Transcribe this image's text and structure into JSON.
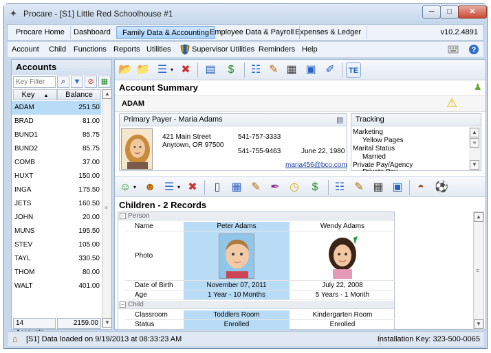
{
  "window": {
    "title": "Procare - [S1] Little Red Schoolhouse #1",
    "min": "─",
    "max": "□",
    "close": "✕"
  },
  "tabs": [
    {
      "label": "Procare Home"
    },
    {
      "label": "Dashboard"
    },
    {
      "label": "Family Data & Accounting"
    },
    {
      "label": "Employee Data & Payroll"
    },
    {
      "label": "Expenses & Ledger"
    }
  ],
  "version": "v10.2.4891",
  "menu": {
    "account": "Account",
    "child": "Child",
    "functions": "Functions",
    "reports": "Reports",
    "utilities": "Utilities",
    "supervisor": "Supervisor Utilities",
    "reminders": "Reminders",
    "help": "Help"
  },
  "sidebar": {
    "title": "Accounts",
    "filter_placeholder": "Key Filter",
    "col_key": "Key",
    "col_balance": "Balance",
    "rows": [
      {
        "key": "ADAM",
        "balance": "251.50"
      },
      {
        "key": "BRAD",
        "balance": "81.00"
      },
      {
        "key": "BUND1",
        "balance": "85.75"
      },
      {
        "key": "BUND2",
        "balance": "85.75"
      },
      {
        "key": "COMB",
        "balance": "37.00"
      },
      {
        "key": "HUXT",
        "balance": "150.00"
      },
      {
        "key": "INGA",
        "balance": "175.50"
      },
      {
        "key": "JETS",
        "balance": "160.50"
      },
      {
        "key": "JOHN",
        "balance": "20.00"
      },
      {
        "key": "MUNS",
        "balance": "195.50"
      },
      {
        "key": "STEV",
        "balance": "105.00"
      },
      {
        "key": "TAYL",
        "balance": "330.50"
      },
      {
        "key": "THOM",
        "balance": "80.00"
      },
      {
        "key": "WALT",
        "balance": "401.00"
      }
    ],
    "footer_count": "14 Accounts",
    "footer_total": "2159.00"
  },
  "summary": {
    "title": "Account Summary",
    "account_key": "ADAM",
    "primary_payer_label": "Primary Payer - Maria Adams",
    "address1": "421 Main Street",
    "address2": "Anytown, OR  97500",
    "phone1": "541-757-3333",
    "phone2": "541-755-9463",
    "date": "June 22, 1980",
    "email": "maria456@bco.com",
    "tracking_title": "Tracking",
    "tracking": [
      "Marketing",
      "Yellow Pages",
      "Marital Status",
      "Married",
      "Private Pay/Agency",
      "Private Pay"
    ]
  },
  "children": {
    "title": "Children - 2 Records",
    "group_person": "Person",
    "group_child": "Child",
    "labels": {
      "name": "Name",
      "photo": "Photo",
      "dob": "Date of Birth",
      "age": "Age",
      "classroom": "Classroom",
      "status": "Status"
    },
    "kids": [
      {
        "name": "Peter Adams",
        "dob": "November 07, 2011",
        "age": "1 Year - 10 Months",
        "classroom": "Toddlers Room",
        "status": "Enrolled"
      },
      {
        "name": "Wendy Adams",
        "dob": "July 22, 2008",
        "age": "5 Years - 1 Month",
        "classroom": "Kindergarten Room",
        "status": "Enrolled"
      }
    ]
  },
  "status": {
    "left": "[S1] Data loaded on 9/19/2013 at 08:33:23 AM",
    "right": "Installation Key: 323-500-0065"
  },
  "colors": {
    "accent": "#b9dcf6",
    "tab_active": "#a9d2fb",
    "frame": "#c9d9ec"
  }
}
